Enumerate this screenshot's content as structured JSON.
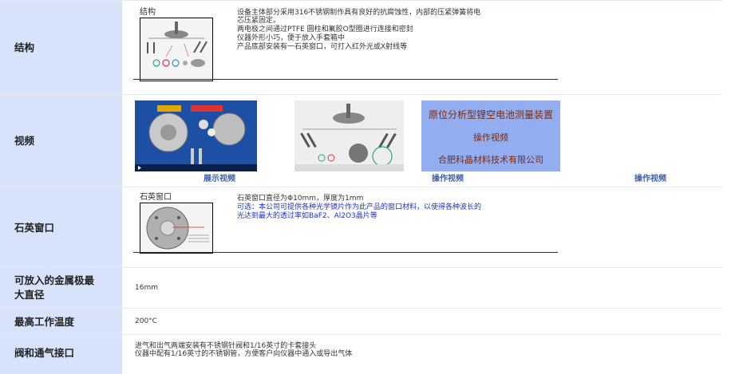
{
  "rows": {
    "structure": {
      "label": "结构",
      "caption": "结构",
      "lines": [
        "设备主体部分采用316不锈钢制作具有良好的抗腐蚀性，内部的压紧弹簧将电",
        "芯压紧固定。",
        "两电极之间通过PTFE 圆柱和氟胶O型圈进行连接和密封",
        "仪器外形小巧，便于放入手套箱中",
        "产品底部安装有一石英窗口，可打入红外光或X射线等"
      ]
    },
    "video": {
      "label": "视频",
      "items": [
        {
          "link": "展示视频"
        },
        {
          "link": "操作视频"
        },
        {
          "link": "操作视频"
        }
      ],
      "poster": {
        "title": "原位分析型锂空电池测量装置",
        "subtitle": "操作视频",
        "company": "合肥科晶材料技术有限公司"
      }
    },
    "window": {
      "label": "石英窗口",
      "caption": "石英窗口",
      "line1": "石英窗口直径为Φ10mm，厚度为1mm",
      "line2": "可选：本公司可提供各种光学镜片作为此产品的窗口材料，以使得各种波长的",
      "line3": "光达到最大的透过率如BaF2、Al2O3晶片等"
    },
    "maxdia": {
      "label_line1": "可放入的金属极最",
      "label_line2": "大直径",
      "value": "16mm"
    },
    "temp": {
      "label": "最高工作温度",
      "value": "200°C"
    },
    "valve": {
      "label": "阀和通气接口",
      "line1": "进气和出气两端安装有不锈钢针阀和1/16英寸的卡套接头",
      "line2": "仪器中配有1/16英寸的不锈钢管，方便客户向仪器中通入或导出气体"
    }
  },
  "colors": {
    "label_bg": "#d7e3fb",
    "link": "#3b5ea8",
    "highlight": "#1d2fd6",
    "poster_bg": "#92aef0",
    "poster_text": "#7a2a10"
  }
}
